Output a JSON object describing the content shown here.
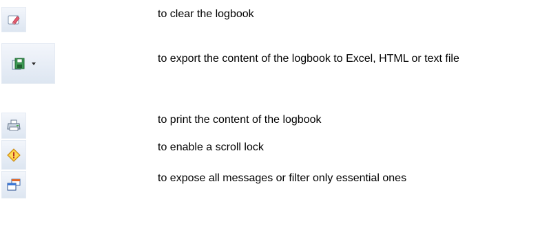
{
  "items": [
    {
      "icon": "eraser-icon",
      "label": "to clear the logbook"
    },
    {
      "icon": "save-export-icon",
      "label": "to export the content of the logbook to Excel, HTML or text file"
    },
    {
      "icon": "printer-icon",
      "label": "to print the content of the logbook"
    },
    {
      "icon": "scroll-lock-warning-icon",
      "label": "to enable a scroll lock"
    },
    {
      "icon": "filter-windows-icon",
      "label": "to expose all messages or filter only essential ones"
    }
  ]
}
